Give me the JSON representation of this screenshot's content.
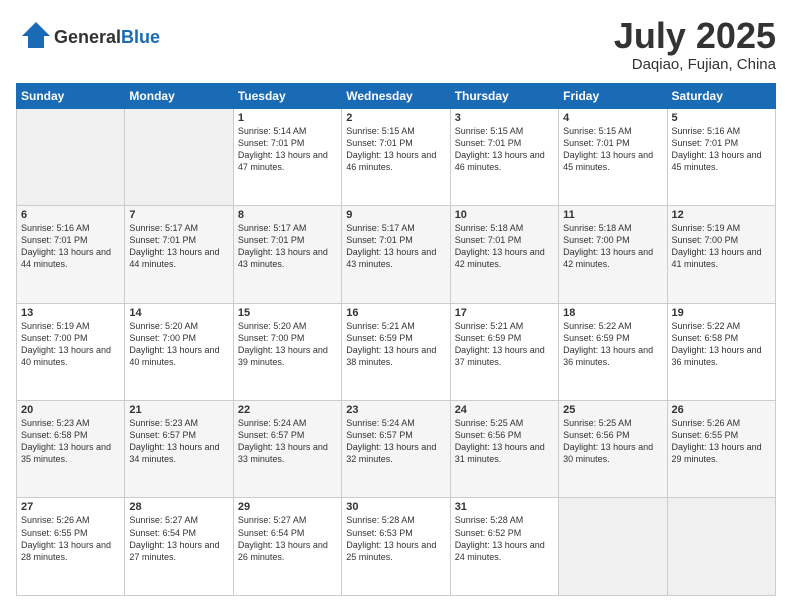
{
  "logo": {
    "general": "General",
    "blue": "Blue"
  },
  "header": {
    "month": "July 2025",
    "location": "Daqiao, Fujian, China"
  },
  "weekdays": [
    "Sunday",
    "Monday",
    "Tuesday",
    "Wednesday",
    "Thursday",
    "Friday",
    "Saturday"
  ],
  "weeks": [
    [
      {
        "day": "",
        "sunrise": "",
        "sunset": "",
        "daylight": ""
      },
      {
        "day": "",
        "sunrise": "",
        "sunset": "",
        "daylight": ""
      },
      {
        "day": "1",
        "sunrise": "Sunrise: 5:14 AM",
        "sunset": "Sunset: 7:01 PM",
        "daylight": "Daylight: 13 hours and 47 minutes."
      },
      {
        "day": "2",
        "sunrise": "Sunrise: 5:15 AM",
        "sunset": "Sunset: 7:01 PM",
        "daylight": "Daylight: 13 hours and 46 minutes."
      },
      {
        "day": "3",
        "sunrise": "Sunrise: 5:15 AM",
        "sunset": "Sunset: 7:01 PM",
        "daylight": "Daylight: 13 hours and 46 minutes."
      },
      {
        "day": "4",
        "sunrise": "Sunrise: 5:15 AM",
        "sunset": "Sunset: 7:01 PM",
        "daylight": "Daylight: 13 hours and 45 minutes."
      },
      {
        "day": "5",
        "sunrise": "Sunrise: 5:16 AM",
        "sunset": "Sunset: 7:01 PM",
        "daylight": "Daylight: 13 hours and 45 minutes."
      }
    ],
    [
      {
        "day": "6",
        "sunrise": "Sunrise: 5:16 AM",
        "sunset": "Sunset: 7:01 PM",
        "daylight": "Daylight: 13 hours and 44 minutes."
      },
      {
        "day": "7",
        "sunrise": "Sunrise: 5:17 AM",
        "sunset": "Sunset: 7:01 PM",
        "daylight": "Daylight: 13 hours and 44 minutes."
      },
      {
        "day": "8",
        "sunrise": "Sunrise: 5:17 AM",
        "sunset": "Sunset: 7:01 PM",
        "daylight": "Daylight: 13 hours and 43 minutes."
      },
      {
        "day": "9",
        "sunrise": "Sunrise: 5:17 AM",
        "sunset": "Sunset: 7:01 PM",
        "daylight": "Daylight: 13 hours and 43 minutes."
      },
      {
        "day": "10",
        "sunrise": "Sunrise: 5:18 AM",
        "sunset": "Sunset: 7:01 PM",
        "daylight": "Daylight: 13 hours and 42 minutes."
      },
      {
        "day": "11",
        "sunrise": "Sunrise: 5:18 AM",
        "sunset": "Sunset: 7:00 PM",
        "daylight": "Daylight: 13 hours and 42 minutes."
      },
      {
        "day": "12",
        "sunrise": "Sunrise: 5:19 AM",
        "sunset": "Sunset: 7:00 PM",
        "daylight": "Daylight: 13 hours and 41 minutes."
      }
    ],
    [
      {
        "day": "13",
        "sunrise": "Sunrise: 5:19 AM",
        "sunset": "Sunset: 7:00 PM",
        "daylight": "Daylight: 13 hours and 40 minutes."
      },
      {
        "day": "14",
        "sunrise": "Sunrise: 5:20 AM",
        "sunset": "Sunset: 7:00 PM",
        "daylight": "Daylight: 13 hours and 40 minutes."
      },
      {
        "day": "15",
        "sunrise": "Sunrise: 5:20 AM",
        "sunset": "Sunset: 7:00 PM",
        "daylight": "Daylight: 13 hours and 39 minutes."
      },
      {
        "day": "16",
        "sunrise": "Sunrise: 5:21 AM",
        "sunset": "Sunset: 6:59 PM",
        "daylight": "Daylight: 13 hours and 38 minutes."
      },
      {
        "day": "17",
        "sunrise": "Sunrise: 5:21 AM",
        "sunset": "Sunset: 6:59 PM",
        "daylight": "Daylight: 13 hours and 37 minutes."
      },
      {
        "day": "18",
        "sunrise": "Sunrise: 5:22 AM",
        "sunset": "Sunset: 6:59 PM",
        "daylight": "Daylight: 13 hours and 36 minutes."
      },
      {
        "day": "19",
        "sunrise": "Sunrise: 5:22 AM",
        "sunset": "Sunset: 6:58 PM",
        "daylight": "Daylight: 13 hours and 36 minutes."
      }
    ],
    [
      {
        "day": "20",
        "sunrise": "Sunrise: 5:23 AM",
        "sunset": "Sunset: 6:58 PM",
        "daylight": "Daylight: 13 hours and 35 minutes."
      },
      {
        "day": "21",
        "sunrise": "Sunrise: 5:23 AM",
        "sunset": "Sunset: 6:57 PM",
        "daylight": "Daylight: 13 hours and 34 minutes."
      },
      {
        "day": "22",
        "sunrise": "Sunrise: 5:24 AM",
        "sunset": "Sunset: 6:57 PM",
        "daylight": "Daylight: 13 hours and 33 minutes."
      },
      {
        "day": "23",
        "sunrise": "Sunrise: 5:24 AM",
        "sunset": "Sunset: 6:57 PM",
        "daylight": "Daylight: 13 hours and 32 minutes."
      },
      {
        "day": "24",
        "sunrise": "Sunrise: 5:25 AM",
        "sunset": "Sunset: 6:56 PM",
        "daylight": "Daylight: 13 hours and 31 minutes."
      },
      {
        "day": "25",
        "sunrise": "Sunrise: 5:25 AM",
        "sunset": "Sunset: 6:56 PM",
        "daylight": "Daylight: 13 hours and 30 minutes."
      },
      {
        "day": "26",
        "sunrise": "Sunrise: 5:26 AM",
        "sunset": "Sunset: 6:55 PM",
        "daylight": "Daylight: 13 hours and 29 minutes."
      }
    ],
    [
      {
        "day": "27",
        "sunrise": "Sunrise: 5:26 AM",
        "sunset": "Sunset: 6:55 PM",
        "daylight": "Daylight: 13 hours and 28 minutes."
      },
      {
        "day": "28",
        "sunrise": "Sunrise: 5:27 AM",
        "sunset": "Sunset: 6:54 PM",
        "daylight": "Daylight: 13 hours and 27 minutes."
      },
      {
        "day": "29",
        "sunrise": "Sunrise: 5:27 AM",
        "sunset": "Sunset: 6:54 PM",
        "daylight": "Daylight: 13 hours and 26 minutes."
      },
      {
        "day": "30",
        "sunrise": "Sunrise: 5:28 AM",
        "sunset": "Sunset: 6:53 PM",
        "daylight": "Daylight: 13 hours and 25 minutes."
      },
      {
        "day": "31",
        "sunrise": "Sunrise: 5:28 AM",
        "sunset": "Sunset: 6:52 PM",
        "daylight": "Daylight: 13 hours and 24 minutes."
      },
      {
        "day": "",
        "sunrise": "",
        "sunset": "",
        "daylight": ""
      },
      {
        "day": "",
        "sunrise": "",
        "sunset": "",
        "daylight": ""
      }
    ]
  ]
}
